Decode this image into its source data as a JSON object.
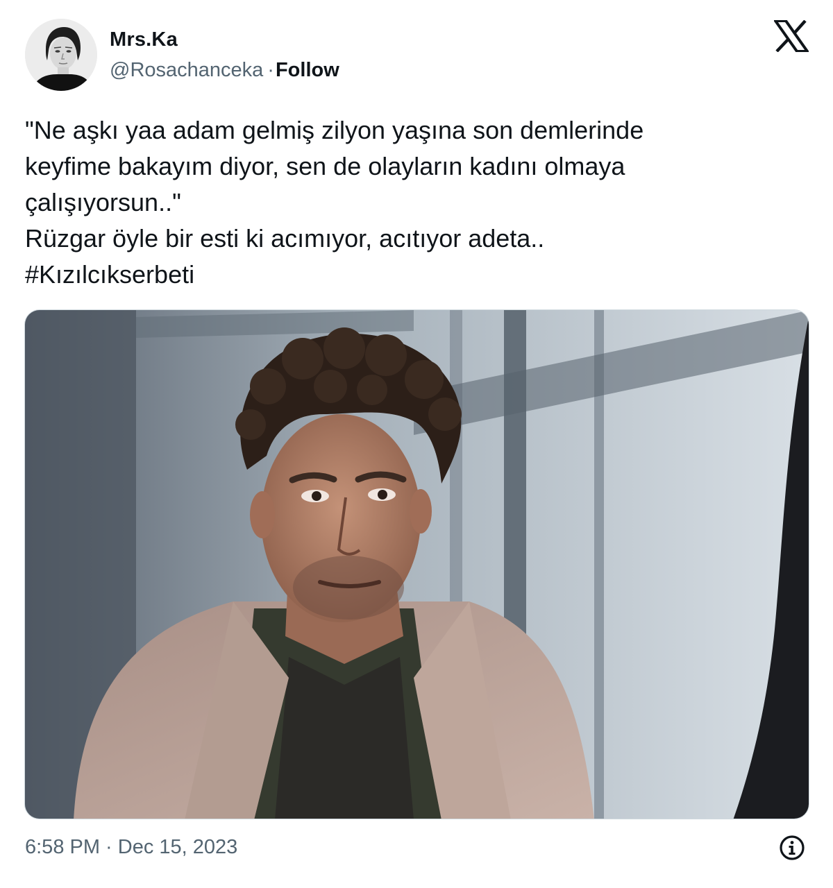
{
  "author": {
    "display_name": "Mrs.Ka",
    "handle": "@Rosachanceka",
    "separator": "·",
    "follow_label": "Follow"
  },
  "brand_icon": "x-logo-icon",
  "tweet": {
    "lines": [
      "\"Ne aşkı yaa adam gelmiş zilyon yaşına son demlerinde",
      "keyfime bakayım diyor, sen de olayların kadını olmaya",
      "çalışıyorsun..\"",
      "Rüzgar öyle bir esti ki acımıyor, acıtıyor adeta..",
      "#Kızılcıkserbeti"
    ]
  },
  "footer": {
    "timestamp": "6:58 PM · Dec 15, 2023",
    "info_icon": "info-icon"
  },
  "colors": {
    "text_primary": "#0f1419",
    "text_secondary": "#536471"
  }
}
